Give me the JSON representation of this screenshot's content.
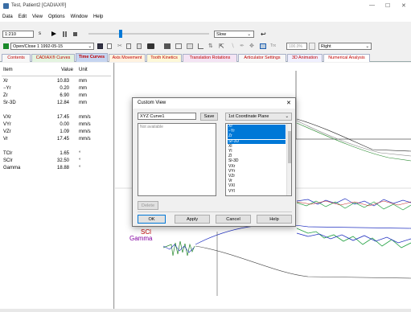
{
  "window": {
    "title": "Test, Patient2 [CADIAX®]",
    "minimize": "—",
    "maximize": "☐",
    "close": "✕"
  },
  "menu": [
    "Data",
    "Edit",
    "View",
    "Options",
    "Window",
    "Help"
  ],
  "toolbar": {
    "time_value": "1:210",
    "time_unit": "s",
    "speed": "Slow",
    "zoom": "100.0%",
    "side": "Right",
    "grid_label": "Trx"
  },
  "recording": {
    "label": "Open/Close 1 1992-05-15"
  },
  "tabs": [
    "Contents",
    "CADIAX® Curves",
    "Time Curves",
    "Axis Movement",
    "Tooth Kinetics",
    "Translation Rotations",
    "Articulator Settings",
    "3D Animation",
    "Numerical Analysis"
  ],
  "table": {
    "headers": [
      "Item",
      "Value",
      "Unit"
    ],
    "rows": [
      [
        "Xr",
        "10.83",
        "mm"
      ],
      [
        "−Yr",
        "0.20",
        "mm"
      ],
      [
        "Zr",
        "6.90",
        "mm"
      ],
      [
        "Sr-3D",
        "12.84",
        "mm"
      ],
      [
        "",
        "",
        "",
        ""
      ],
      [
        "VXr",
        "17.45",
        "mm/s"
      ],
      [
        "VYr",
        "0.00",
        "mm/s"
      ],
      [
        "VZr",
        "1.09",
        "mm/s"
      ],
      [
        "Vr",
        "17.45",
        "mm/s"
      ],
      [
        "",
        "",
        "",
        ""
      ],
      [
        "TClr",
        "1.65",
        "°"
      ],
      [
        "SClr",
        "32.50",
        "°"
      ],
      [
        "Gamma",
        "18.88",
        "°"
      ]
    ]
  },
  "plot_labels": {
    "scl": "SCl",
    "gamma": "Gamma"
  },
  "dialog": {
    "title": "Custom View",
    "close": "✕",
    "name_value": "XYZ Curve1",
    "save": "Save",
    "plane": "1st Coordinate Plane",
    "left_list": [
      "Not available"
    ],
    "right_list": [
      "Xr",
      "−Yr",
      "Zr",
      "Sr-3D",
      "Xl",
      "Yl",
      "Zl",
      "Sl-3D",
      "VXr",
      "VYr",
      "VZr",
      "Vr",
      "VXl",
      "VYl"
    ],
    "selected": [
      0,
      1,
      2,
      3
    ],
    "delete": "Delete",
    "ok": "OK",
    "apply": "Apply",
    "cancel": "Cancel",
    "help": "Help"
  },
  "colors": {
    "accent": "#0078d7",
    "tab_active": "#c5d4f0",
    "curve_blue": "#2030c0",
    "curve_green": "#20a040",
    "curve_red": "#c02020",
    "label_red": "#c00000",
    "label_purple": "#8000a0"
  }
}
